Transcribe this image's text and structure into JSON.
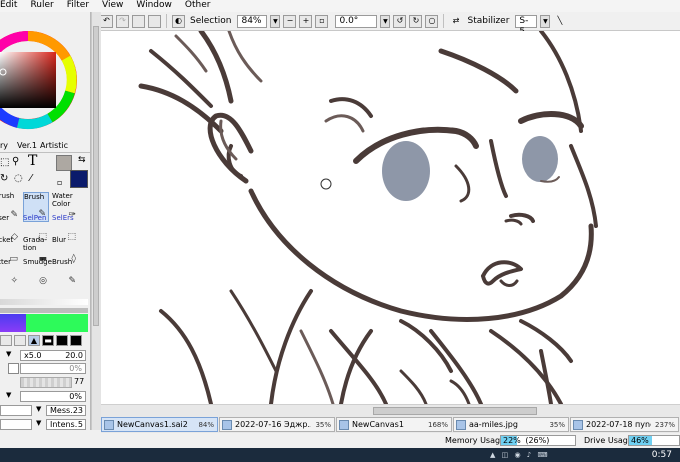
{
  "menu": {
    "items": [
      "Edit",
      "Ruler",
      "Filter",
      "View",
      "Window",
      "Other"
    ],
    "underline": [
      "E",
      "R",
      "i",
      "V",
      "W",
      "O"
    ]
  },
  "toolbar": {
    "selection_label": "Selection",
    "zoom_value": "84%",
    "rotation_value": "0.0°",
    "stabilizer_label": "Stabilizer",
    "stabilizer_value": "S-5"
  },
  "color_panel": {
    "tabs": [
      "ry",
      "Ver.1",
      "Artistic"
    ],
    "primary_color": "#ada8a2",
    "secondary_color": "#0b1b6b"
  },
  "tools": [
    {
      "label": "Brush",
      "sub": "",
      "selected": false,
      "blue": false
    },
    {
      "label": "Brush",
      "sub": "",
      "selected": true,
      "blue": false
    },
    {
      "label": "Water",
      "sub": "Color",
      "selected": false,
      "blue": false
    },
    {
      "label": "aser",
      "sub": "",
      "selected": false,
      "blue": false
    },
    {
      "label": "SelPen",
      "sub": "",
      "selected": false,
      "blue": true
    },
    {
      "label": "SelErs",
      "sub": "",
      "selected": false,
      "blue": true
    },
    {
      "label": "ucket",
      "sub": "",
      "selected": false,
      "blue": false
    },
    {
      "label": "Grada-",
      "sub": "tion",
      "selected": false,
      "blue": false
    },
    {
      "label": "Blur",
      "sub": "",
      "selected": false,
      "blue": false
    },
    {
      "label": "atter",
      "sub": "",
      "selected": false,
      "blue": false
    },
    {
      "label": "Smudge",
      "sub": "",
      "selected": false,
      "blue": false
    },
    {
      "label": "Brush",
      "sub": "",
      "selected": false,
      "blue": false
    }
  ],
  "brush_settings": {
    "size_mult": "x5.0",
    "size_value": "20.0",
    "min_size": "0%",
    "density": "77",
    "blending": "0%",
    "mess_label": "Mess.",
    "mess_value": "23",
    "intens_label": "Intens.",
    "intens_value": "5"
  },
  "tabs": [
    {
      "name": "NewCanvas1.sai2",
      "percent": "84%",
      "active": true
    },
    {
      "name": "2022-07-16 Эджр...",
      "percent": "35%",
      "active": false
    },
    {
      "name": "NewCanvas1",
      "percent": "168%",
      "active": false
    },
    {
      "name": "aa-miles.jpg",
      "percent": "35%",
      "active": false
    },
    {
      "name": "2022-07-18 пуnc...",
      "percent": "237%",
      "active": false
    }
  ],
  "status": {
    "memory_label": "Memory Usage",
    "memory_value": "22%",
    "memory_detail": "(26%)",
    "memory_fraction": 0.22,
    "drive_label": "Drive Usage",
    "drive_value": "46%",
    "drive_fraction": 0.46
  },
  "taskbar": {
    "clock": "0:57"
  }
}
